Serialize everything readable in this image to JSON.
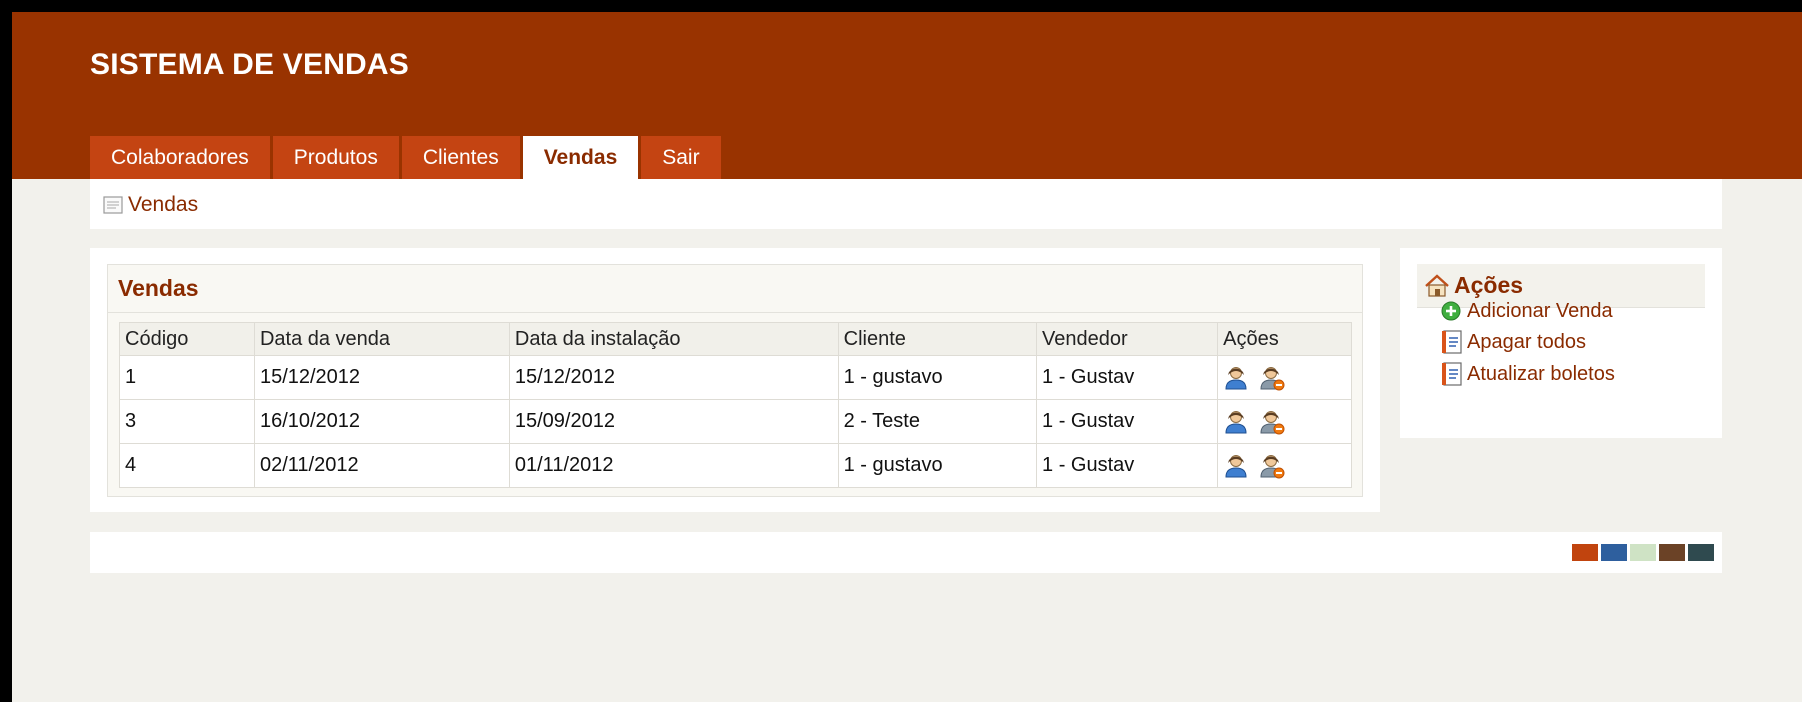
{
  "header": {
    "title": "SISTEMA DE VENDAS"
  },
  "tabs": [
    {
      "label": "Colaboradores",
      "active": false
    },
    {
      "label": "Produtos",
      "active": false
    },
    {
      "label": "Clientes",
      "active": false
    },
    {
      "label": "Vendas",
      "active": true
    },
    {
      "label": "Sair",
      "active": false
    }
  ],
  "breadcrumb": {
    "label": "Vendas",
    "icon": "page-icon"
  },
  "vendas": {
    "title": "Vendas",
    "columns": [
      "Código",
      "Data da venda",
      "Data da instalação",
      "Cliente",
      "Vendedor",
      "Ações"
    ],
    "rows": [
      {
        "codigo": "1",
        "data_venda": "15/12/2012",
        "data_instalacao": "15/12/2012",
        "cliente": "1 - gustavo",
        "vendedor": "1 - Gustav"
      },
      {
        "codigo": "3",
        "data_venda": "16/10/2012",
        "data_instalacao": "15/09/2012",
        "cliente": "2 - Teste",
        "vendedor": "1 - Gustav"
      },
      {
        "codigo": "4",
        "data_venda": "02/11/2012",
        "data_instalacao": "01/11/2012",
        "cliente": "1 - gustavo",
        "vendedor": "1 - Gustav"
      }
    ],
    "row_action_icons": [
      "user-edit-icon",
      "user-delete-icon"
    ]
  },
  "acoes": {
    "title": "Ações",
    "title_icon": "home-icon",
    "links": [
      {
        "label": "Adicionar Venda",
        "icon": "add-circle-icon"
      },
      {
        "label": "Apagar todos",
        "icon": "document-icon"
      },
      {
        "label": "Atualizar boletos",
        "icon": "document-icon"
      }
    ]
  },
  "theme_swatches": [
    "#c1440e",
    "#2e5f9e",
    "#cfe3c5",
    "#6b4226",
    "#2f4a4f"
  ],
  "colors": {
    "header": "#993300",
    "tab": "#c44412",
    "accent": "#8a2b00"
  }
}
